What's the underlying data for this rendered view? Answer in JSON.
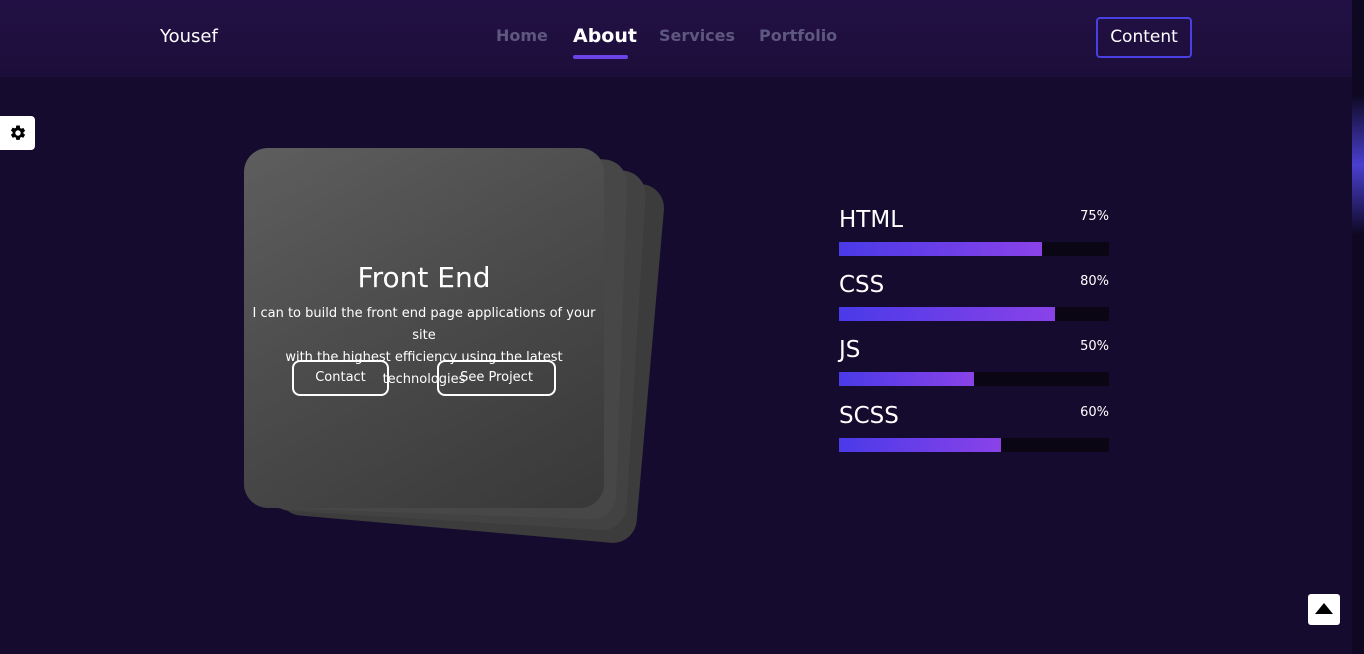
{
  "header": {
    "logo": "Yousef",
    "nav": [
      {
        "label": "Home",
        "active": false
      },
      {
        "label": "About",
        "active": true
      },
      {
        "label": "Services",
        "active": false
      },
      {
        "label": "Portfolio",
        "active": false
      }
    ],
    "content_button": "Content"
  },
  "settings": {
    "icon": "gear-icon"
  },
  "card": {
    "title": "Front End",
    "description_line1": "I can to build the front end page applications of your site",
    "description_line2": "with the highest efficiency using the latest technologies",
    "contact_button": "Contact",
    "project_button": "See Project"
  },
  "skills": [
    {
      "name": "HTML",
      "percent_label": "75%",
      "level": 0.75
    },
    {
      "name": "CSS",
      "percent_label": "80%",
      "level": 0.8
    },
    {
      "name": "JS",
      "percent_label": "50%",
      "level": 0.5
    },
    {
      "name": "SCSS",
      "percent_label": "60%",
      "level": 0.6
    }
  ],
  "scroll_top": {
    "icon": "caret-up-icon"
  },
  "colors": {
    "background": "#150b2e",
    "accent": "#6b43e8",
    "button_border": "#4a3fe0",
    "bar_start": "#4a3ae8",
    "bar_end": "#8a42e8"
  }
}
